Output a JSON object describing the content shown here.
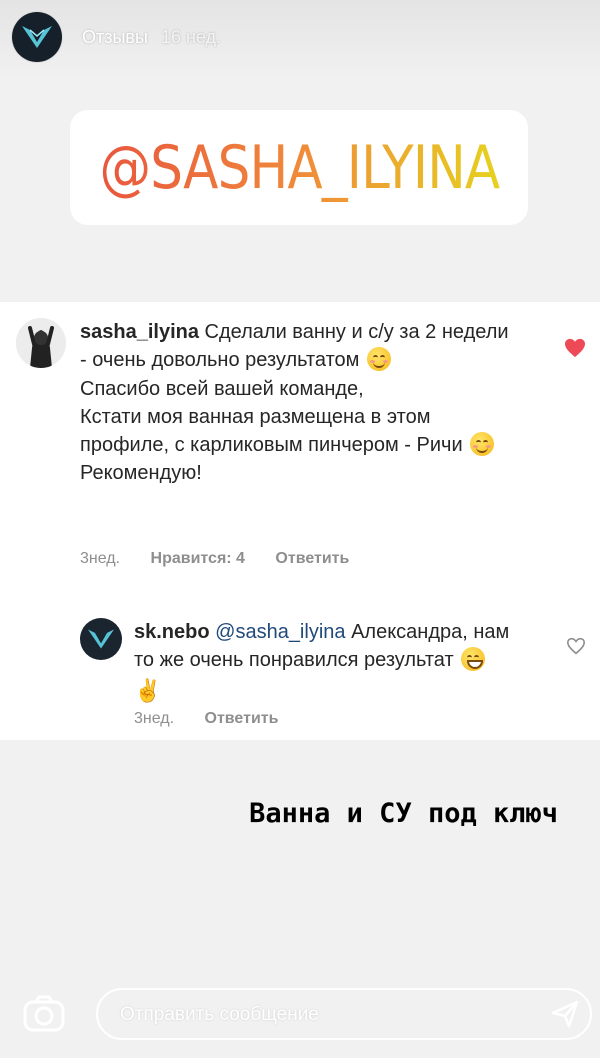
{
  "story": {
    "title": "Отзывы",
    "time": "16 нед.",
    "sticker_text": "@SASHA_ILYINA",
    "caption": "Ванна и СУ под ключ"
  },
  "comments": [
    {
      "username": "sasha_ilyina",
      "line1": "Сделали ванну и с/у за 2 недели - очень довольно результатом",
      "line2": "Спасибо всей вашей команде,",
      "line3": "Кстати моя ванная размещена в этом профиле, с карликовым пинчером - Ричи",
      "line4": "Рекомендую!",
      "time": "3нед.",
      "likes": "Нравится: 4",
      "reply": "Ответить",
      "liked": true,
      "heart_color": "#ed4956"
    },
    {
      "username": "sk.nebo",
      "mention": "@sasha_ilyina",
      "text": "Александра, нам то же очень понравился результат",
      "time": "3нед.",
      "reply": "Ответить",
      "liked": false
    }
  ],
  "message_bar": {
    "placeholder": "Отправить сообщение"
  },
  "icons": {
    "camera": "camera-icon",
    "send": "send-icon",
    "heart": "heart-icon"
  }
}
